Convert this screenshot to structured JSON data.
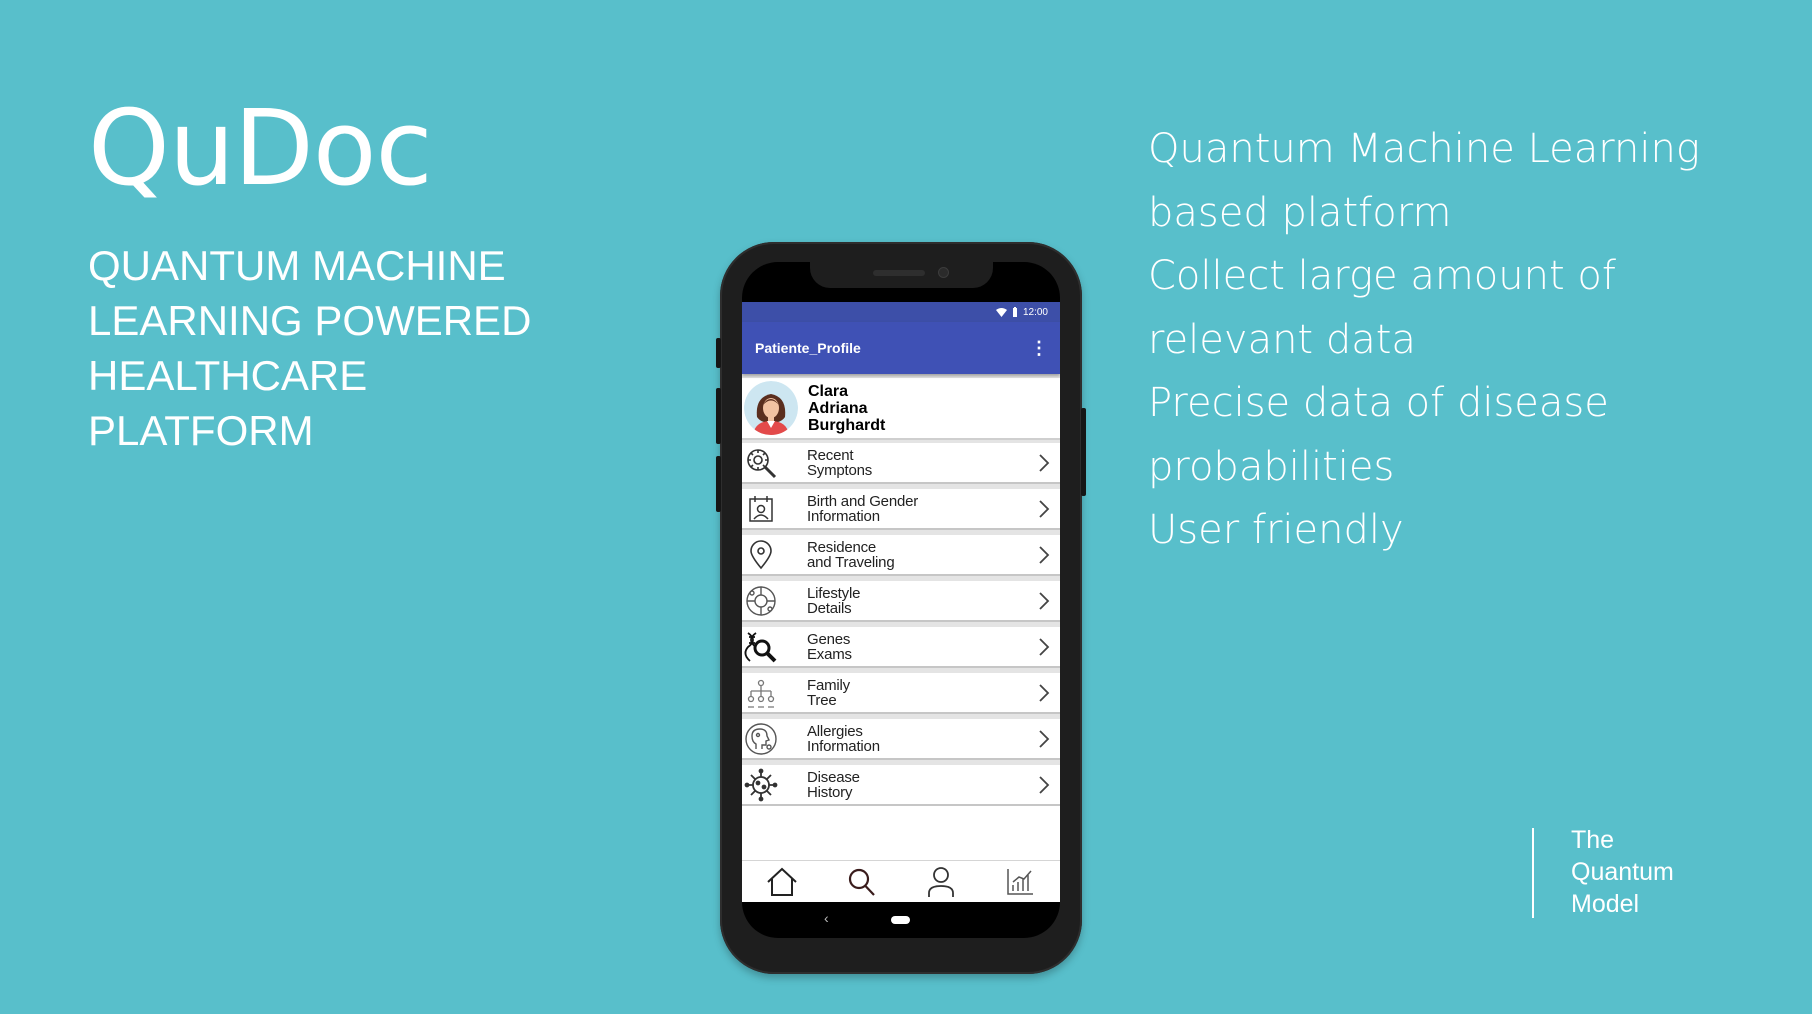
{
  "brand": {
    "title": "QuDoc",
    "tagline": "QUANTUM MACHINE LEARNING POWERED HEALTHCARE PLATFORM"
  },
  "features": [
    "Quantum Machine Learning",
    "based platform",
    "Collect large amount of",
    "relevant data",
    "Precise data of disease",
    "probabilities",
    "User friendly"
  ],
  "logo": {
    "line1": "The",
    "line2": "Quantum",
    "line3": "Model"
  },
  "phone": {
    "status_time": "12:00",
    "app_title": "Patiente_Profile",
    "profile": {
      "first": "Clara",
      "middle": "Adriana",
      "last": "Burghardt"
    },
    "menu": [
      {
        "line1": "Recent",
        "line2": "Symptons",
        "icon": "virus-magnifier-icon"
      },
      {
        "line1": "Birth and Gender",
        "line2": "Information",
        "icon": "id-card-icon"
      },
      {
        "line1": "Residence",
        "line2": "and Traveling",
        "icon": "location-pin-icon"
      },
      {
        "line1": "Lifestyle",
        "line2": "Details",
        "icon": "lifestyle-globe-icon"
      },
      {
        "line1": "Genes",
        "line2": "Exams",
        "icon": "dna-search-icon"
      },
      {
        "line1": "Family",
        "line2": "Tree",
        "icon": "family-tree-icon"
      },
      {
        "line1": "Allergies",
        "line2": "Information",
        "icon": "allergy-head-icon"
      },
      {
        "line1": "Disease",
        "line2": "History",
        "icon": "virus-icon"
      }
    ],
    "bottom_nav": [
      "home-icon",
      "search-icon",
      "user-icon",
      "chart-icon"
    ]
  },
  "colors": {
    "background": "#58bfcb",
    "appbar": "#3f51b5",
    "statusbar": "#3d4fa8",
    "phone_body": "#1e1e1e"
  }
}
